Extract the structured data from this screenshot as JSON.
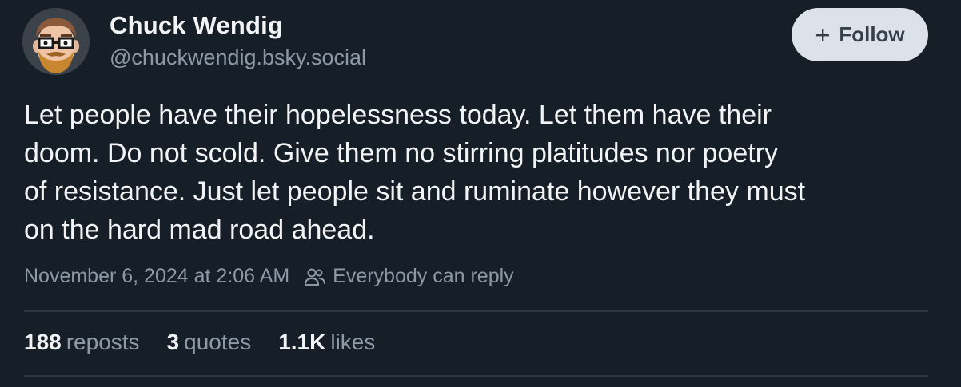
{
  "author": {
    "name": "Chuck Wendig",
    "handle": "@chuckwendig.bsky.social",
    "avatar_icon": "cartoon-avatar-icon"
  },
  "follow_button": {
    "label": "Follow",
    "icon": "plus-icon"
  },
  "post": {
    "lines": [
      "Let people have their hopelessness today. Let them have their",
      "doom. Do not scold. Give them no stirring platitudes nor poetry",
      "of resistance. Just let people sit and ruminate however they must",
      "on the hard mad road ahead."
    ],
    "timestamp": "November 6, 2024 at 2:06 AM",
    "reply_setting": "Everybody can reply",
    "reply_icon": "people-icon"
  },
  "stats": {
    "reposts": {
      "count": "188",
      "label": "reposts"
    },
    "quotes": {
      "count": "3",
      "label": "quotes"
    },
    "likes": {
      "count": "1.1K",
      "label": "likes"
    }
  },
  "colors": {
    "background": "#161e27",
    "text_primary": "#f1f3f5",
    "text_secondary": "#8d99a6",
    "button_bg": "#dce2ea",
    "divider": "#2c3743"
  }
}
